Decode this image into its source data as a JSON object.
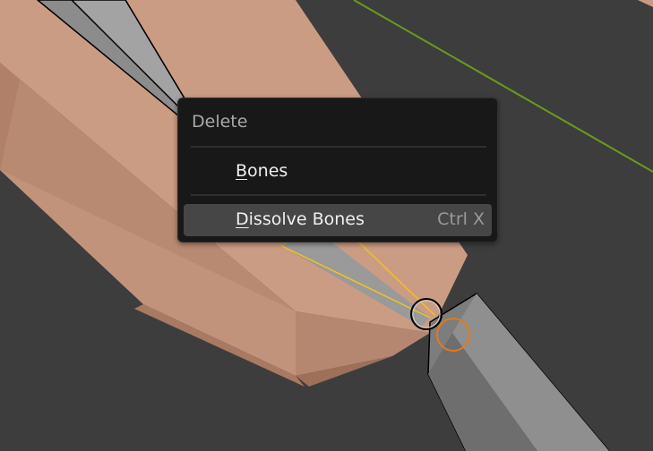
{
  "colors": {
    "background": "#3d3d3d",
    "mesh_light": "#c99a82",
    "mesh_dark": "#b08069",
    "bone_gray": "#808080",
    "selected_orange": "#e07a1f",
    "axis_green": "#6a9a1e",
    "selection_yellow": "#f2c21b",
    "menu_bg": "#181818",
    "menu_hover": "#464646"
  },
  "menu": {
    "title": "Delete",
    "items": [
      {
        "accel": "B",
        "rest": "ones",
        "shortcut": ""
      },
      {
        "accel": "D",
        "rest": "issolve Bones",
        "shortcut": "Ctrl X"
      }
    ]
  }
}
